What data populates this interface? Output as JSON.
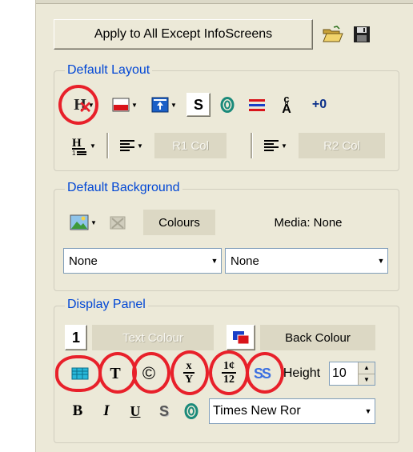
{
  "apply_button_label": "Apply to All Except InfoScreens",
  "toolbar_icons": [
    "open-folder-icon",
    "save-disk-icon"
  ],
  "default_layout": {
    "legend": "Default Layout",
    "shadow_button": "S",
    "indent_label": "+0",
    "r1_label": "R1 Col",
    "r2_label": "R2 Col"
  },
  "default_background": {
    "legend": "Default Background",
    "colours_label": "Colours",
    "media_label": "Media: None",
    "combo1_value": "None",
    "combo2_value": "None"
  },
  "display_panel": {
    "legend": "Display Panel",
    "number_box": "1",
    "text_colour_label": "Text Colour",
    "back_colour_label": "Back Colour",
    "t_label": "T",
    "copyright_label": "©",
    "height_label": "Height",
    "height_value": "10",
    "bold_label": "B",
    "italic_label": "I",
    "underline_label": "U",
    "strike_label": "S",
    "font_value": "Times New Ror"
  },
  "colors": {
    "panel_bg": "#ece9d8",
    "legend_blue": "#0046d5",
    "highlight_red": "#e8202a"
  }
}
